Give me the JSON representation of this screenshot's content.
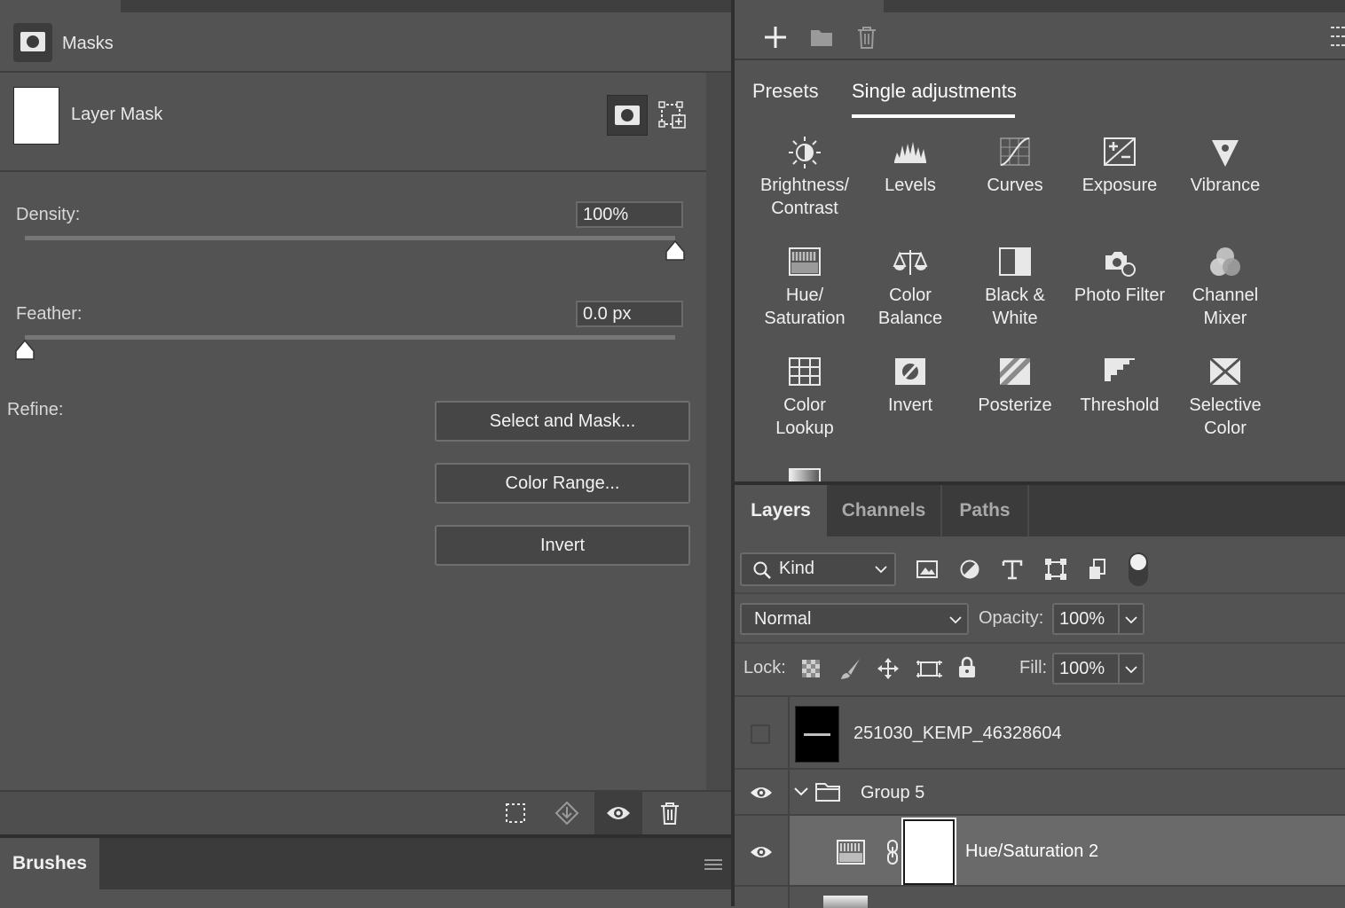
{
  "masks": {
    "title": "Masks",
    "layer_mask_label": "Layer Mask",
    "density_label": "Density:",
    "density_value": "100%",
    "density_level": 1.0,
    "feather_label": "Feather:",
    "feather_value": "0.0 px",
    "feather_level": 0.0,
    "refine_label": "Refine:",
    "buttons": [
      "Select and Mask...",
      "Color Range...",
      "Invert"
    ]
  },
  "brushes": {
    "tab_label": "Brushes"
  },
  "adjustments": {
    "tabs": [
      "Presets",
      "Single adjustments"
    ],
    "active_tab": "Single adjustments",
    "items": [
      {
        "label1": "Brightness/",
        "label2": "Contrast",
        "icon": "brightness-contrast-icon"
      },
      {
        "label1": "Levels",
        "label2": "",
        "icon": "levels-icon"
      },
      {
        "label1": "Curves",
        "label2": "",
        "icon": "curves-icon"
      },
      {
        "label1": "Exposure",
        "label2": "",
        "icon": "exposure-icon"
      },
      {
        "label1": "Vibrance",
        "label2": "",
        "icon": "vibrance-icon"
      },
      {
        "label1": "Hue/",
        "label2": "Saturation",
        "icon": "hue-saturation-icon"
      },
      {
        "label1": "Color",
        "label2": "Balance",
        "icon": "color-balance-icon"
      },
      {
        "label1": "Black &",
        "label2": "White",
        "icon": "black-white-icon"
      },
      {
        "label1": "Photo Filter",
        "label2": "",
        "icon": "photo-filter-icon"
      },
      {
        "label1": "Channel",
        "label2": "Mixer",
        "icon": "channel-mixer-icon"
      },
      {
        "label1": "Color",
        "label2": "Lookup",
        "icon": "color-lookup-icon"
      },
      {
        "label1": "Invert",
        "label2": "",
        "icon": "invert-icon"
      },
      {
        "label1": "Posterize",
        "label2": "",
        "icon": "posterize-icon"
      },
      {
        "label1": "Threshold",
        "label2": "",
        "icon": "threshold-icon"
      },
      {
        "label1": "Selective",
        "label2": "Color",
        "icon": "selective-color-icon"
      }
    ]
  },
  "layers_panel": {
    "tabs": [
      "Layers",
      "Channels",
      "Paths"
    ],
    "active_tab": "Layers",
    "filter_kind": "Kind",
    "blend_mode": "Normal",
    "opacity_label": "Opacity:",
    "opacity_value": "100%",
    "lock_label": "Lock:",
    "fill_label": "Fill:",
    "fill_value": "100%",
    "layers": [
      {
        "name": "251030_KEMP_46328604",
        "visible": false
      },
      {
        "name": "Group 5",
        "visible": true,
        "type": "group"
      },
      {
        "name": "Hue/Saturation 2",
        "visible": true,
        "type": "adjustment",
        "selected": true
      }
    ]
  },
  "colors": {
    "panel_bg": "#535353",
    "dark_bg": "#3b3b3b",
    "selected_row": "#6a6a6a",
    "text": "#f0f0f0"
  }
}
